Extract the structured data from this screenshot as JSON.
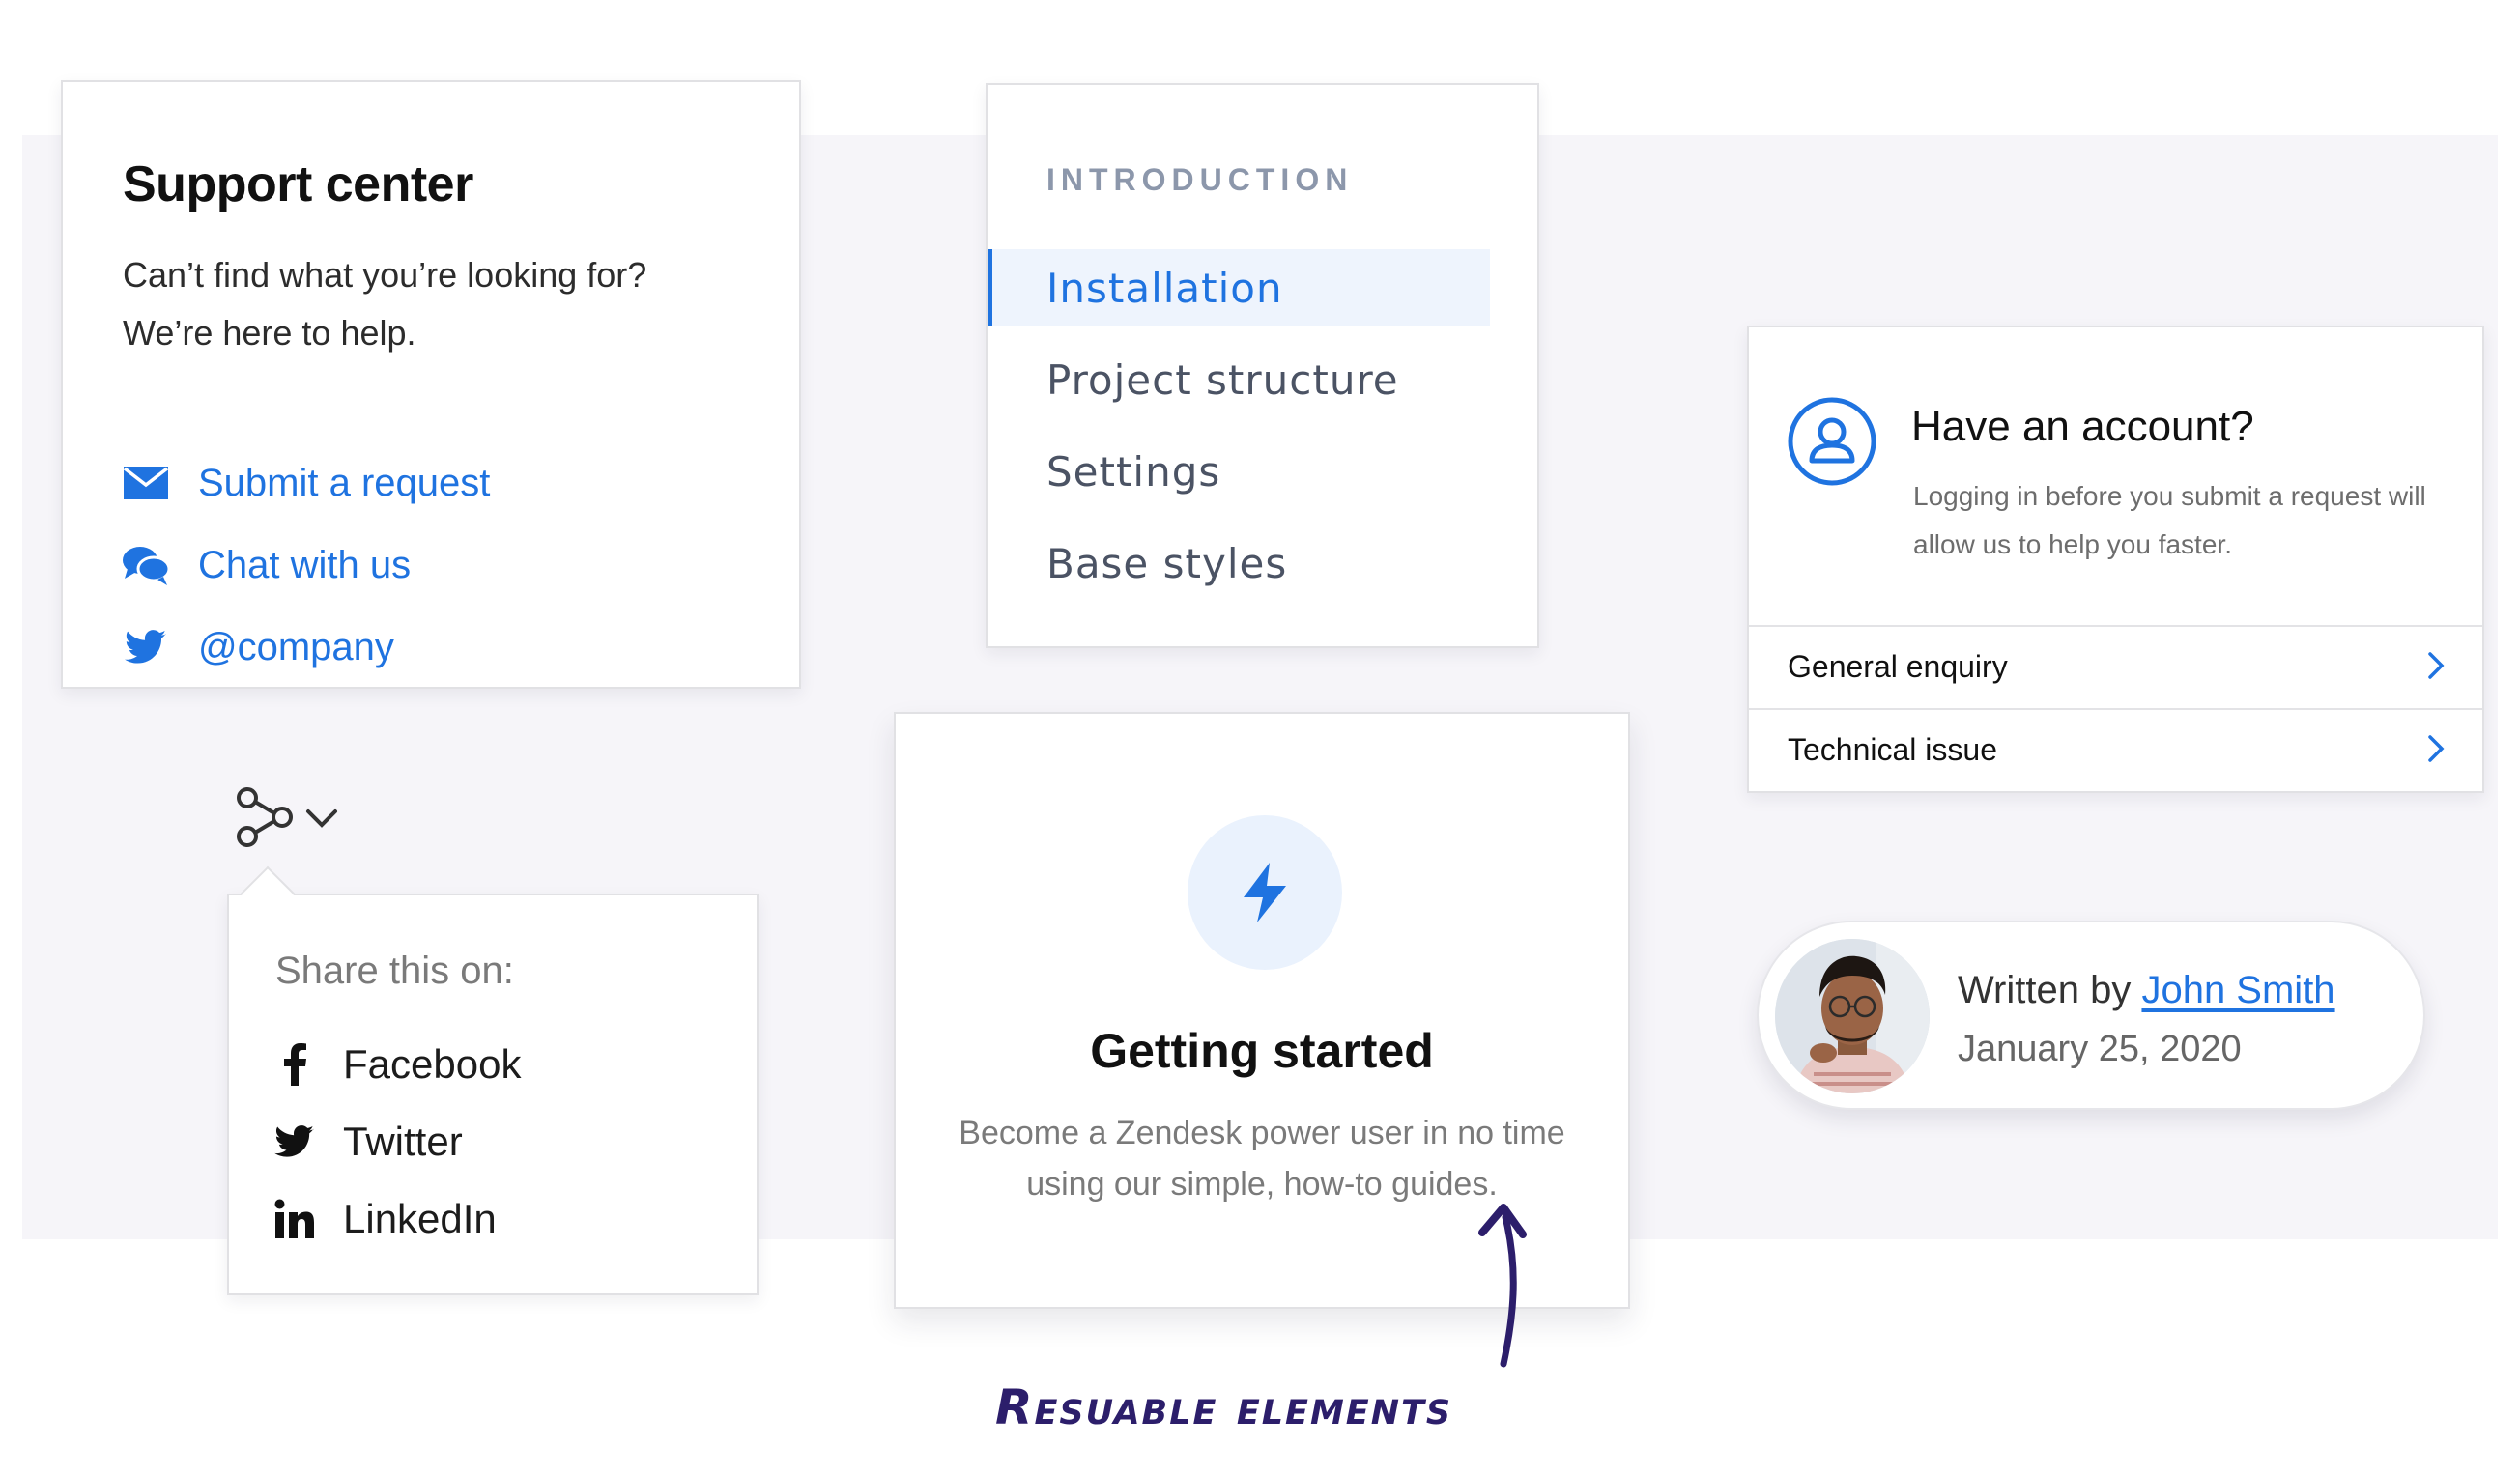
{
  "support": {
    "title": "Support center",
    "description": "Can’t find what you’re looking for? We’re here to help.",
    "links": [
      {
        "label": "Submit a request",
        "icon": "envelope-icon"
      },
      {
        "label": "Chat with us",
        "icon": "chat-bubbles-icon"
      },
      {
        "label": "@company",
        "icon": "twitter-icon"
      }
    ]
  },
  "docnav": {
    "section": "INTRODUCTION",
    "items": [
      {
        "label": "Installation",
        "active": true
      },
      {
        "label": "Project structure",
        "active": false
      },
      {
        "label": "Settings",
        "active": false
      },
      {
        "label": "Base styles",
        "active": false
      }
    ]
  },
  "account": {
    "title": "Have an account?",
    "description": "Logging in before you submit a request will allow us to help you faster.",
    "rows": [
      {
        "label": "General enquiry"
      },
      {
        "label": "Technical issue"
      }
    ]
  },
  "share": {
    "heading": "Share this on:",
    "items": [
      {
        "label": "Facebook",
        "icon": "facebook-icon"
      },
      {
        "label": "Twitter",
        "icon": "twitter-icon"
      },
      {
        "label": "LinkedIn",
        "icon": "linkedin-icon"
      }
    ]
  },
  "getting_started": {
    "title": "Getting started",
    "description": "Become a Zendesk power user in no time using our simple, how-to guides."
  },
  "author": {
    "prefix": "Written by",
    "name": "John Smith",
    "date": "January 25, 2020"
  },
  "annotation": "Resuable elements",
  "colors": {
    "accent": "#1f73e0",
    "band": "#f6f5f9",
    "annotation": "#2c1e6b",
    "section_label": "#8c97ab"
  }
}
